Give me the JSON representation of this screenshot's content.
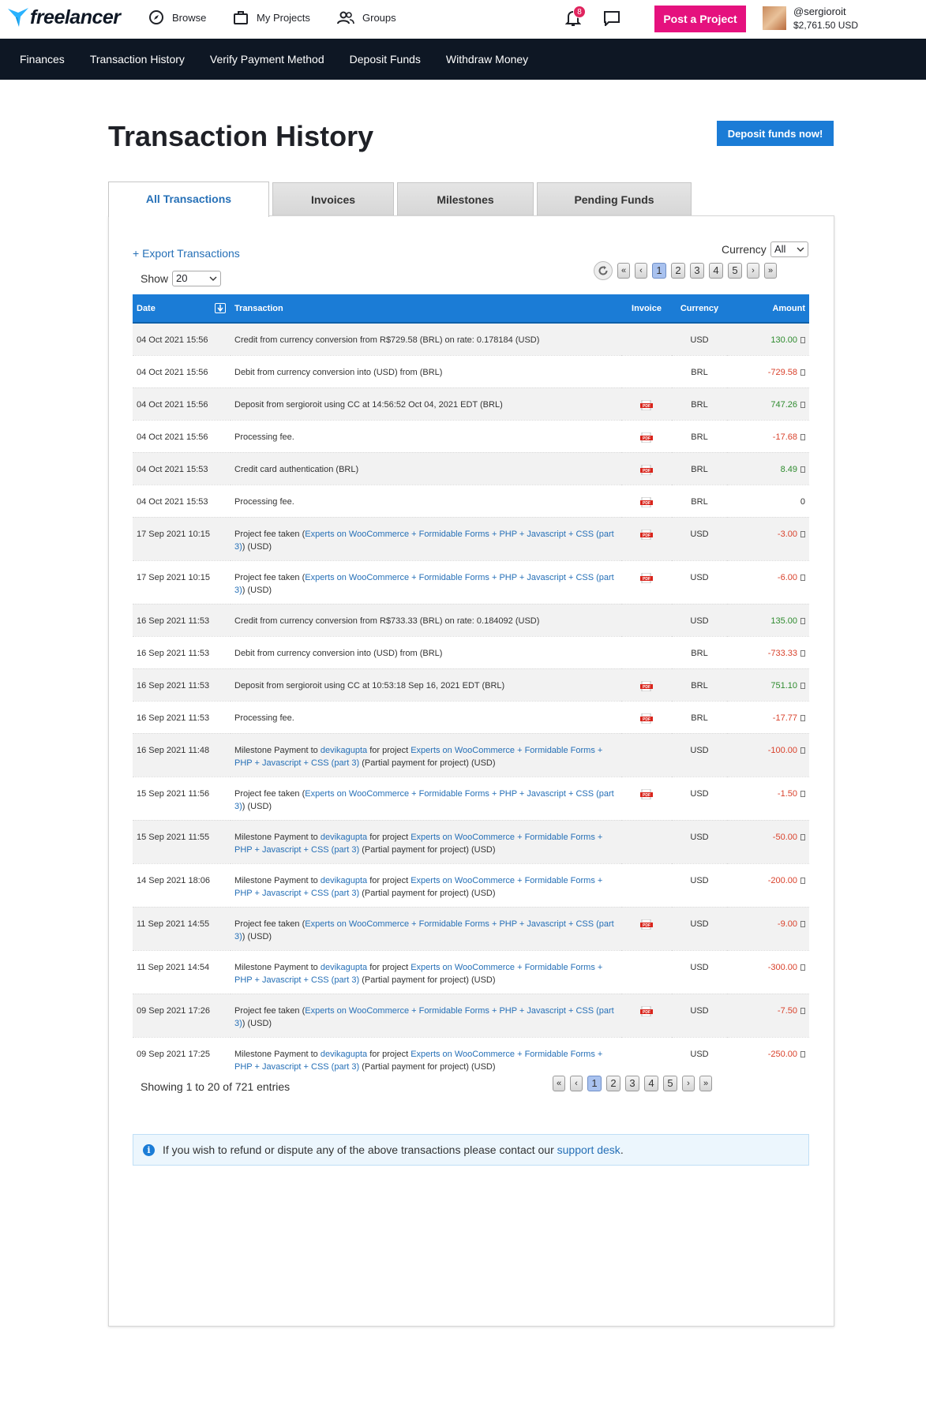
{
  "header": {
    "logo_text": "freelancer",
    "nav": [
      {
        "label": "Browse"
      },
      {
        "label": "My Projects"
      },
      {
        "label": "Groups"
      }
    ],
    "notifications_count": "8",
    "post_project_label": "Post a Project",
    "user": {
      "handle": "@sergioroit",
      "balance": "$2,761.50 USD"
    }
  },
  "subnav": [
    "Finances",
    "Transaction History",
    "Verify Payment Method",
    "Deposit Funds",
    "Withdraw Money"
  ],
  "page": {
    "title": "Transaction History",
    "deposit_button": "Deposit funds now!"
  },
  "tabs": [
    {
      "label": "All Transactions",
      "active": true
    },
    {
      "label": "Invoices",
      "active": false
    },
    {
      "label": "Milestones",
      "active": false
    },
    {
      "label": "Pending Funds",
      "active": false
    }
  ],
  "controls": {
    "export_label": "+ Export Transactions",
    "currency_label": "Currency",
    "currency_value": "All",
    "show_label": "Show",
    "show_value": "20",
    "pager": {
      "first": "«",
      "prev": "‹",
      "pages": [
        "1",
        "2",
        "3",
        "4",
        "5"
      ],
      "current": "1",
      "next": "›",
      "last": "»"
    }
  },
  "table": {
    "columns": {
      "date": "Date",
      "transaction": "Transaction",
      "invoice": "Invoice",
      "currency": "Currency",
      "amount": "Amount"
    },
    "rows": [
      {
        "date": "04 Oct 2021 15:56",
        "parts": [
          {
            "t": "Credit from currency conversion from R$729.58 (BRL) on rate: 0.178184 (USD)"
          }
        ],
        "pdf": false,
        "currency": "USD",
        "amount": "130.00",
        "sign": "pos"
      },
      {
        "date": "04 Oct 2021 15:56",
        "parts": [
          {
            "t": "Debit from currency conversion into (USD) from (BRL)"
          }
        ],
        "pdf": false,
        "currency": "BRL",
        "amount": "-729.58",
        "sign": "neg"
      },
      {
        "date": "04 Oct 2021 15:56",
        "parts": [
          {
            "t": "Deposit from sergioroit using CC at 14:56:52 Oct 04, 2021 EDT (BRL)"
          }
        ],
        "pdf": true,
        "currency": "BRL",
        "amount": "747.26",
        "sign": "pos"
      },
      {
        "date": "04 Oct 2021 15:56",
        "parts": [
          {
            "t": "Processing fee."
          }
        ],
        "pdf": true,
        "currency": "BRL",
        "amount": "-17.68",
        "sign": "neg"
      },
      {
        "date": "04 Oct 2021 15:53",
        "parts": [
          {
            "t": "Credit card authentication (BRL)"
          }
        ],
        "pdf": true,
        "currency": "BRL",
        "amount": "8.49",
        "sign": "pos"
      },
      {
        "date": "04 Oct 2021 15:53",
        "parts": [
          {
            "t": "Processing fee."
          }
        ],
        "pdf": true,
        "currency": "BRL",
        "amount": "0",
        "sign": "zero"
      },
      {
        "date": "17 Sep 2021 10:15",
        "parts": [
          {
            "t": "Project fee taken ("
          },
          {
            "t": "Experts on WooCommerce + Formidable Forms + PHP + Javascript + CSS (part 3)",
            "link": true
          },
          {
            "t": ") (USD)"
          }
        ],
        "pdf": true,
        "currency": "USD",
        "amount": "-3.00",
        "sign": "neg"
      },
      {
        "date": "17 Sep 2021 10:15",
        "parts": [
          {
            "t": "Project fee taken ("
          },
          {
            "t": "Experts on WooCommerce + Formidable Forms + PHP + Javascript + CSS (part 3)",
            "link": true
          },
          {
            "t": ") (USD)"
          }
        ],
        "pdf": true,
        "currency": "USD",
        "amount": "-6.00",
        "sign": "neg"
      },
      {
        "date": "16 Sep 2021 11:53",
        "parts": [
          {
            "t": "Credit from currency conversion from R$733.33 (BRL) on rate: 0.184092 (USD)"
          }
        ],
        "pdf": false,
        "currency": "USD",
        "amount": "135.00",
        "sign": "pos"
      },
      {
        "date": "16 Sep 2021 11:53",
        "parts": [
          {
            "t": "Debit from currency conversion into (USD) from (BRL)"
          }
        ],
        "pdf": false,
        "currency": "BRL",
        "amount": "-733.33",
        "sign": "neg"
      },
      {
        "date": "16 Sep 2021 11:53",
        "parts": [
          {
            "t": "Deposit from sergioroit using CC at 10:53:18 Sep 16, 2021 EDT (BRL)"
          }
        ],
        "pdf": true,
        "currency": "BRL",
        "amount": "751.10",
        "sign": "pos"
      },
      {
        "date": "16 Sep 2021 11:53",
        "parts": [
          {
            "t": "Processing fee."
          }
        ],
        "pdf": true,
        "currency": "BRL",
        "amount": "-17.77",
        "sign": "neg"
      },
      {
        "date": "16 Sep 2021 11:48",
        "parts": [
          {
            "t": "Milestone Payment to "
          },
          {
            "t": "devikagupta",
            "link": true
          },
          {
            "t": " for project "
          },
          {
            "t": "Experts on WooCommerce + Formidable Forms + PHP + Javascript + CSS (part 3)",
            "link": true
          },
          {
            "t": " (Partial payment for project) (USD)"
          }
        ],
        "pdf": false,
        "currency": "USD",
        "amount": "-100.00",
        "sign": "neg"
      },
      {
        "date": "15 Sep 2021 11:56",
        "parts": [
          {
            "t": "Project fee taken ("
          },
          {
            "t": "Experts on WooCommerce + Formidable Forms + PHP + Javascript + CSS (part 3)",
            "link": true
          },
          {
            "t": ") (USD)"
          }
        ],
        "pdf": true,
        "currency": "USD",
        "amount": "-1.50",
        "sign": "neg"
      },
      {
        "date": "15 Sep 2021 11:55",
        "parts": [
          {
            "t": "Milestone Payment to "
          },
          {
            "t": "devikagupta",
            "link": true
          },
          {
            "t": " for project "
          },
          {
            "t": "Experts on WooCommerce + Formidable Forms + PHP + Javascript + CSS (part 3)",
            "link": true
          },
          {
            "t": " (Partial payment for project) (USD)"
          }
        ],
        "pdf": false,
        "currency": "USD",
        "amount": "-50.00",
        "sign": "neg"
      },
      {
        "date": "14 Sep 2021 18:06",
        "parts": [
          {
            "t": "Milestone Payment to "
          },
          {
            "t": "devikagupta",
            "link": true
          },
          {
            "t": " for project "
          },
          {
            "t": "Experts on WooCommerce + Formidable Forms + PHP + Javascript + CSS (part 3)",
            "link": true
          },
          {
            "t": " (Partial payment for project) (USD)"
          }
        ],
        "pdf": false,
        "currency": "USD",
        "amount": "-200.00",
        "sign": "neg"
      },
      {
        "date": "11 Sep 2021 14:55",
        "parts": [
          {
            "t": "Project fee taken ("
          },
          {
            "t": "Experts on WooCommerce + Formidable Forms + PHP + Javascript + CSS (part 3)",
            "link": true
          },
          {
            "t": ") (USD)"
          }
        ],
        "pdf": true,
        "currency": "USD",
        "amount": "-9.00",
        "sign": "neg"
      },
      {
        "date": "11 Sep 2021 14:54",
        "parts": [
          {
            "t": "Milestone Payment to "
          },
          {
            "t": "devikagupta",
            "link": true
          },
          {
            "t": " for project "
          },
          {
            "t": "Experts on WooCommerce + Formidable Forms + PHP + Javascript + CSS (part 3)",
            "link": true
          },
          {
            "t": " (Partial payment for project) (USD)"
          }
        ],
        "pdf": false,
        "currency": "USD",
        "amount": "-300.00",
        "sign": "neg"
      },
      {
        "date": "09 Sep 2021 17:26",
        "parts": [
          {
            "t": "Project fee taken ("
          },
          {
            "t": "Experts on WooCommerce + Formidable Forms + PHP + Javascript + CSS (part 3)",
            "link": true
          },
          {
            "t": ") (USD)"
          }
        ],
        "pdf": true,
        "currency": "USD",
        "amount": "-7.50",
        "sign": "neg"
      },
      {
        "date": "09 Sep 2021 17:25",
        "parts": [
          {
            "t": "Milestone Payment to "
          },
          {
            "t": "devikagupta",
            "link": true
          },
          {
            "t": " for project "
          },
          {
            "t": "Experts on WooCommerce + Formidable Forms + PHP + Javascript + CSS (part 3)",
            "link": true
          },
          {
            "t": " (Partial payment for project) (USD)"
          }
        ],
        "pdf": false,
        "currency": "USD",
        "amount": "-250.00",
        "sign": "neg"
      }
    ]
  },
  "footer": {
    "showing": "Showing 1 to 20 of 721 entries",
    "alert_text": "If you wish to refund or dispute any of the above transactions please contact our ",
    "alert_link": "support desk",
    "alert_end": "."
  },
  "icons": {
    "logo": "freelancer-bird-logo",
    "browse": "compass-icon",
    "projects": "briefcase-icon",
    "groups": "users-icon",
    "bell": "bell-icon",
    "chat": "chat-icon",
    "refresh": "refresh-icon",
    "pdf": "pdf-icon",
    "info": "info-icon"
  },
  "colors": {
    "brand_pink": "#e5117e",
    "primary_blue": "#1b7cd6",
    "nav_dark": "#0e1724",
    "positive": "#2e8b2e",
    "negative": "#d9422c"
  }
}
